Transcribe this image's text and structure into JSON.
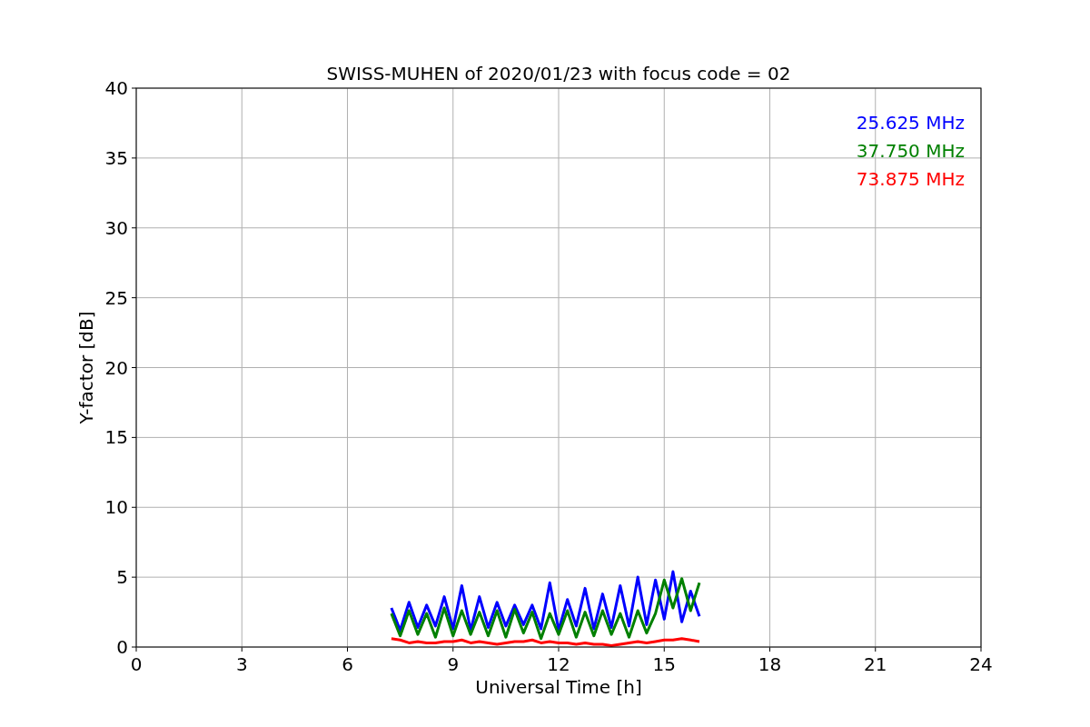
{
  "figure": {
    "chart_data": {
      "type": "line",
      "title": "SWISS-MUHEN of 2020/01/23 with focus code = 02",
      "xlabel": "Universal Time [h]",
      "ylabel": "Y-factor [dB]",
      "x": [
        7.25,
        7.5,
        7.75,
        8,
        8.25,
        8.5,
        8.75,
        9,
        9.25,
        9.5,
        9.75,
        10,
        10.25,
        10.5,
        10.75,
        11,
        11.25,
        11.5,
        11.75,
        12,
        12.25,
        12.5,
        12.75,
        13,
        13.25,
        13.5,
        13.75,
        14,
        14.25,
        14.5,
        14.75,
        15,
        15.25,
        15.5,
        15.75,
        16
      ],
      "series": [
        {
          "name": "25.625 MHz",
          "color": "#0000ff",
          "values": [
            2.8,
            1.2,
            3.2,
            1.4,
            3.0,
            1.5,
            3.6,
            1.3,
            4.4,
            1.2,
            3.6,
            1.4,
            3.2,
            1.5,
            3.0,
            1.6,
            3.0,
            1.3,
            4.6,
            1.2,
            3.4,
            1.5,
            4.2,
            1.3,
            3.8,
            1.4,
            4.4,
            1.5,
            5.0,
            1.6,
            4.8,
            2.0,
            5.4,
            1.8,
            4.0,
            2.2
          ]
        },
        {
          "name": "37.750 MHz",
          "color": "#008000",
          "values": [
            2.4,
            0.8,
            2.6,
            0.9,
            2.4,
            0.7,
            2.8,
            0.8,
            2.6,
            0.9,
            2.5,
            0.8,
            2.6,
            0.7,
            2.7,
            1.0,
            2.5,
            0.6,
            2.4,
            0.9,
            2.6,
            0.7,
            2.5,
            0.8,
            2.6,
            0.9,
            2.4,
            0.7,
            2.6,
            1.0,
            2.4,
            4.8,
            2.8,
            4.9,
            2.6,
            4.6
          ]
        },
        {
          "name": "73.875 MHz",
          "color": "#ff0000",
          "values": [
            0.6,
            0.5,
            0.3,
            0.4,
            0.3,
            0.3,
            0.4,
            0.4,
            0.5,
            0.3,
            0.4,
            0.3,
            0.2,
            0.3,
            0.4,
            0.4,
            0.5,
            0.3,
            0.4,
            0.3,
            0.3,
            0.2,
            0.3,
            0.2,
            0.2,
            0.1,
            0.2,
            0.3,
            0.4,
            0.3,
            0.4,
            0.5,
            0.5,
            0.6,
            0.5,
            0.4
          ]
        }
      ],
      "grid": true,
      "xlim": [
        0,
        24
      ],
      "ylim": [
        0,
        40
      ],
      "xticks": [
        0,
        3,
        6,
        9,
        12,
        15,
        18,
        21,
        24
      ],
      "yticks": [
        0,
        5,
        10,
        15,
        20,
        25,
        30,
        35,
        40
      ]
    }
  }
}
